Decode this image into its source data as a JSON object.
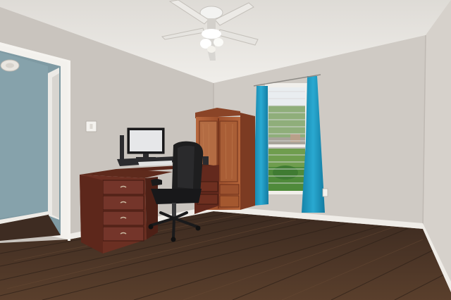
{
  "scene": {
    "colors": {
      "wall": "#cdc8c2",
      "right_wall": "#d3cec8",
      "ceiling": "#ebe9e5",
      "floor": "#4a3426",
      "hall_wall": "#7f9aa3",
      "curtain": "#1f9dc4",
      "desk_wood": "#6b2f22",
      "cabinet_wood": "#a85a34",
      "trim": "#f2f0ec",
      "chair": "#1e1e1f",
      "window_sky": "#e9edf0",
      "window_green": "#6f9d4e"
    },
    "icons": [
      "ceiling-fan",
      "desk",
      "office-chair",
      "monitor",
      "armoire",
      "window",
      "curtains",
      "doorway",
      "smoke-detector"
    ]
  }
}
